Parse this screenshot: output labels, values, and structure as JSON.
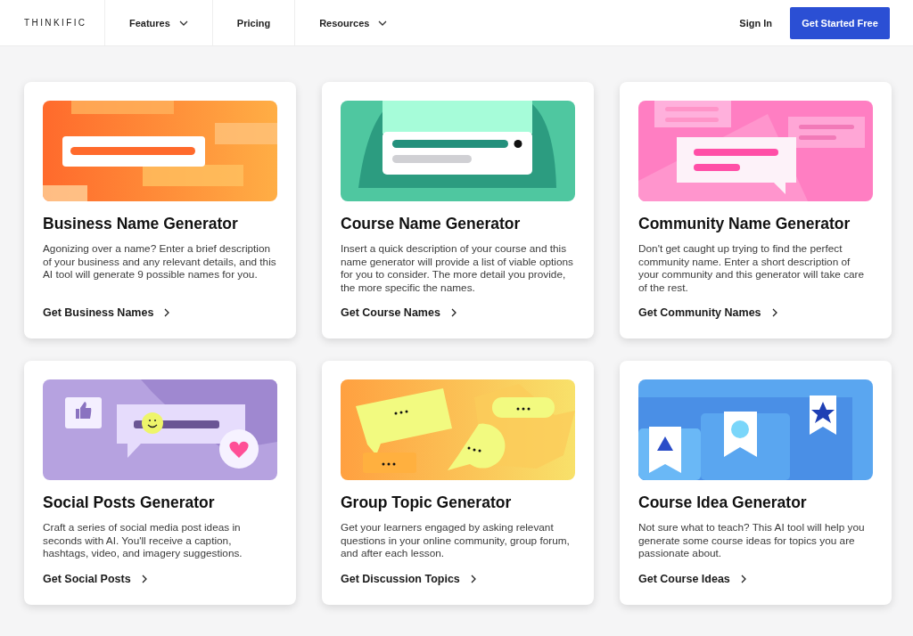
{
  "header": {
    "logo": "THINKIFIC",
    "nav": [
      {
        "label": "Features",
        "dropdown": true
      },
      {
        "label": "Pricing",
        "dropdown": false
      },
      {
        "label": "Resources",
        "dropdown": true
      }
    ],
    "sign_in": "Sign In",
    "cta": "Get Started Free"
  },
  "cards": [
    {
      "kind": "business",
      "title": "Business Name Generator",
      "description": "Agonizing over a name? Enter a brief description of your business and any relevant details, and this AI tool will generate 9 possible names for you.",
      "link": "Get Business Names"
    },
    {
      "kind": "course",
      "title": "Course Name Generator",
      "description": "Insert a quick description of your course and this name generator will provide a list of viable options for you to consider. The more detail you provide, the more specific the names.",
      "link": "Get Course Names"
    },
    {
      "kind": "community",
      "title": "Community Name Generator",
      "description": "Don't get caught up trying to find the perfect community name. Enter a short description of your community and this generator will take care of the rest.",
      "link": "Get Community Names"
    },
    {
      "kind": "social",
      "title": "Social Posts Generator",
      "description": "Craft a series of social media post ideas in seconds with AI. You'll receive a caption, hashtags, video, and imagery suggestions.",
      "link": "Get Social Posts"
    },
    {
      "kind": "topic",
      "title": "Group Topic Generator",
      "description": "Get your learners engaged by asking relevant questions in your online community, group forum, and after each lesson.",
      "link": "Get Discussion Topics"
    },
    {
      "kind": "idea",
      "title": "Course Idea Generator",
      "description": "Not sure what to teach? This AI tool will help you generate some course ideas for topics you are passionate about.",
      "link": "Get Course Ideas"
    }
  ]
}
